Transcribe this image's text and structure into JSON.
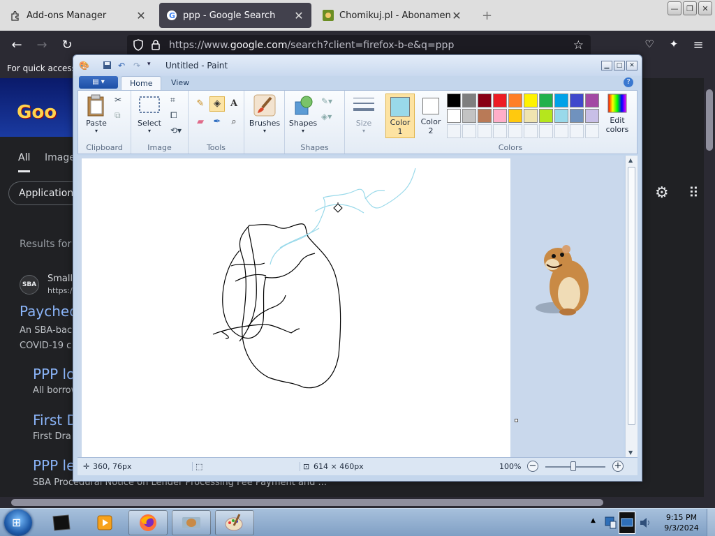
{
  "browser": {
    "tabs": [
      {
        "title": "Add-ons Manager",
        "icon": "puzzle-icon"
      },
      {
        "title": "ppp - Google Search",
        "icon": "google-icon",
        "active": true
      },
      {
        "title": "Chomikuj.pl - Abonamenty i Do",
        "icon": "chomikuj-icon"
      }
    ],
    "new_tab": "+",
    "url_prefix": "https://www.",
    "url_host": "google.com",
    "url_rest": "/search?client=firefox-b-e&q=ppp",
    "bookmarks_text": "For quick access,"
  },
  "google": {
    "tab_all": "All",
    "tab_images": "Images",
    "chip": "Application",
    "results_for": "Results for I",
    "source_icon_text": "SBA",
    "source_name": "Small",
    "source_url": "https:/",
    "results": [
      {
        "title": "Payched",
        "snippet": "An SBA-bac"
      },
      {
        "title": "PPP lo",
        "snippet": "All borrow"
      },
      {
        "title": "First D",
        "snippet": "First Dra"
      },
      {
        "title": "PPP le",
        "snippet": "SBA Procedural Notice on Lender Processing Fee Payment and ..."
      }
    ],
    "snippet_line2": "COVID-19 c"
  },
  "paint": {
    "title": "Untitled - Paint",
    "tabs": {
      "home": "Home",
      "view": "View"
    },
    "groups": {
      "clipboard": "Clipboard",
      "image": "Image",
      "tools": "Tools",
      "shapes": "Shapes",
      "colors": "Colors"
    },
    "buttons": {
      "paste": "Paste",
      "select": "Select",
      "brushes": "Brushes",
      "shapes": "Shapes",
      "size": "Size",
      "color1_a": "Color",
      "color1_b": "1",
      "color2_a": "Color",
      "color2_b": "2",
      "edit_colors_a": "Edit",
      "edit_colors_b": "colors"
    },
    "color1": "#99d9ea",
    "color2": "#ffffff",
    "palette_row1": [
      "#000000",
      "#7f7f7f",
      "#880015",
      "#ed1c24",
      "#ff7f27",
      "#fff200",
      "#22b14c",
      "#00a2e8",
      "#3f48cc",
      "#a349a4"
    ],
    "palette_row2": [
      "#ffffff",
      "#c3c3c3",
      "#b97a57",
      "#ffaec9",
      "#ffc90e",
      "#efe4b0",
      "#b5e61d",
      "#99d9ea",
      "#7092be",
      "#c8bfe7"
    ],
    "status": {
      "cursor_pos": "360, 76px",
      "canvas_size": "614 × 460px",
      "zoom": "100%"
    }
  },
  "taskbar": {
    "time": "9:15 PM",
    "date": "9/3/2024"
  }
}
